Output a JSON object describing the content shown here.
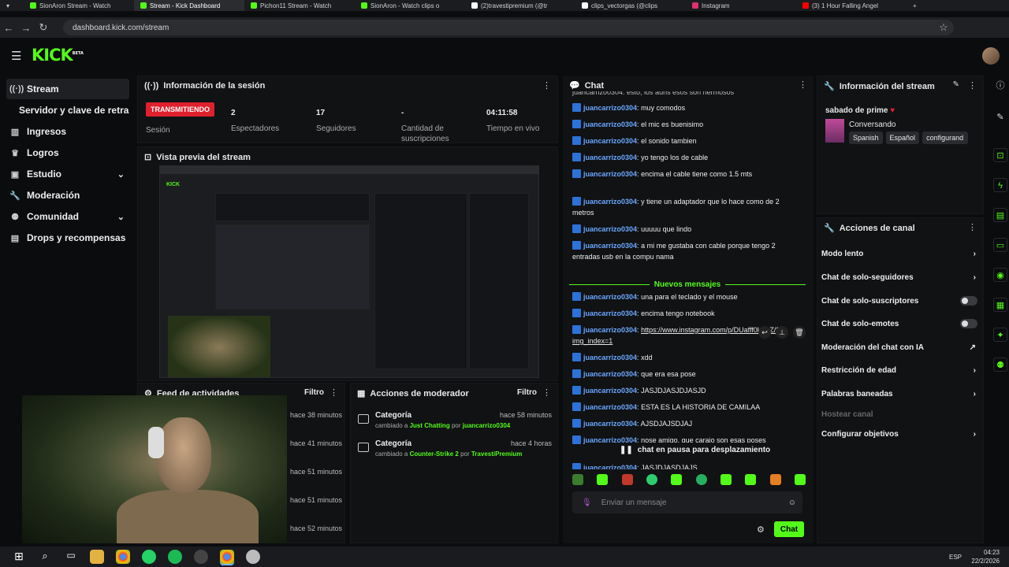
{
  "browser": {
    "tabs": [
      {
        "label": "SionAron Stream - Watch"
      },
      {
        "label": "Stream - Kick Dashboard",
        "active": true
      },
      {
        "label": "Pichon11 Stream - Watch"
      },
      {
        "label": "SionAron - Watch clips o"
      },
      {
        "label": "(2)travestipremium (@tr"
      },
      {
        "label": "clips_vectorgas (@clips"
      },
      {
        "label": "Instagram"
      },
      {
        "label": "(3) 1 Hour Falling Angel"
      }
    ],
    "url": "dashboard.kick.com/stream"
  },
  "header": {
    "logo": "KICK",
    "beta": "BETA"
  },
  "sidebar": {
    "items": [
      {
        "label": "Stream",
        "icon": "broadcast-icon",
        "active": true
      },
      {
        "label": "Servidor y clave de retransm"
      },
      {
        "label": "Ingresos",
        "icon": "bar-chart-icon"
      },
      {
        "label": "Logros",
        "icon": "trophy-icon"
      },
      {
        "label": "Estudio",
        "icon": "studio-icon"
      },
      {
        "label": "Moderación",
        "icon": "wrench-icon"
      },
      {
        "label": "Comunidad",
        "icon": "community-icon"
      },
      {
        "label": "Drops y recompensas",
        "icon": "gift-icon"
      }
    ]
  },
  "session": {
    "title": "Información de la sesión",
    "live_badge": "TRANSMITIENDO",
    "session_label": "Sesión",
    "viewers": "2",
    "viewers_label": "Espectadores",
    "followers": "17",
    "followers_label": "Seguidores",
    "subs": "-",
    "subs_label": "Cantidad de suscripciones",
    "uptime": "04:11:58",
    "uptime_label": "Tiempo en vivo"
  },
  "preview": {
    "title": "Vista previa del stream"
  },
  "feed": {
    "title": "Feed de actividades",
    "filter": "Filtro",
    "times": [
      "hace 38 minutos",
      "hace 41 minutos",
      "hace 51 minutos",
      "hace 51 minutos",
      "hace 52 minutos"
    ]
  },
  "mod_actions": {
    "title": "Acciones de moderador",
    "filter": "Filtro",
    "items": [
      {
        "cat": "Categoría",
        "pre": "cambiado a",
        "target": "Just Chatting",
        "by": "por",
        "user": "juancarrizo0304",
        "time": "hace 58 minutos"
      },
      {
        "cat": "Categoría",
        "pre": "cambiado a",
        "target": "Counter-Strike 2",
        "by": "por",
        "user": "TravestiPremium",
        "time": "hace 4 horas"
      }
    ]
  },
  "chat": {
    "title": "Chat",
    "top_partial": "juancarrizo0304: esto, los auris esos son hermosos",
    "messages_before": [
      {
        "user": "juancarrizo0304",
        "text": "muy comodos"
      },
      {
        "user": "juancarrizo0304",
        "text": "el mic es buenisimo"
      },
      {
        "user": "juancarrizo0304",
        "text": "el sonido tambien"
      },
      {
        "user": "juancarrizo0304",
        "text": "yo tengo los de cable"
      },
      {
        "user": "juancarrizo0304",
        "text": "encima el cable tiene como 1.5 mts"
      },
      {
        "user": "juancarrizo0304",
        "text": "y tiene un adaptador que lo hace como de 2 metros"
      },
      {
        "user": "juancarrizo0304",
        "text": "uuuuu que lindo"
      },
      {
        "user": "juancarrizo0304",
        "text": "a mi me gustaba con cable porque tengo 2 entradas usb en la compu nama"
      }
    ],
    "new_messages": "Nuevos mensajes",
    "messages_after": [
      {
        "user": "juancarrizo0304",
        "text": "una para el teclado y el mouse"
      },
      {
        "user": "juancarrizo0304",
        "text": "encima tengo notebook"
      },
      {
        "user": "juancarrizo0304",
        "text": "https://www.instagram.com/p/DUafff0kXgZ/?img_index=1"
      },
      {
        "user": "juancarrizo0304",
        "text": "xdd"
      },
      {
        "user": "juancarrizo0304",
        "text": "que era esa pose"
      },
      {
        "user": "juancarrizo0304",
        "text": "JASJDJASJDJASJD"
      },
      {
        "user": "juancarrizo0304",
        "text": "ESTA ES LA HISTORIA DE CAMILAA"
      },
      {
        "user": "juancarrizo0304",
        "text": "AJSDJAJSDJAJ"
      },
      {
        "user": "juancarrizo0304",
        "text": "nose amigo, que carajo son esas poses"
      },
      {
        "user": "juancarrizo0304",
        "text": "JASJDJASDJAJS"
      }
    ],
    "partial_user": "juancarr",
    "paused": "chat en pausa para desplazamiento",
    "placeholder": "Enviar un mensaje",
    "send": "Chat"
  },
  "stream_info": {
    "title": "Información del stream",
    "stream_title": "sabado de prime",
    "category": "Conversando",
    "tags": [
      "Spanish",
      "Español",
      "configurand"
    ]
  },
  "channel_actions": {
    "title": "Acciones de canal",
    "items": [
      {
        "label": "Modo lento",
        "type": "chevron"
      },
      {
        "label": "Chat de solo-seguidores",
        "type": "chevron"
      },
      {
        "label": "Chat de solo-suscriptores",
        "type": "toggle"
      },
      {
        "label": "Chat de solo-emotes",
        "type": "toggle"
      },
      {
        "label": "Moderación del chat con IA",
        "type": "external"
      },
      {
        "label": "Restricción de edad",
        "type": "chevron"
      },
      {
        "label": "Palabras baneadas",
        "type": "chevron"
      },
      {
        "label": "Hostear canal",
        "type": "disabled"
      },
      {
        "label": "Configurar objetivos",
        "type": "chevron"
      }
    ]
  },
  "taskbar": {
    "time": "04:23",
    "date": "22/2/2026",
    "lang": "ESP"
  },
  "colors": {
    "accent": "#53fc18",
    "live": "#e0202d",
    "bg": "#0b0c0e",
    "panel": "#111214"
  }
}
